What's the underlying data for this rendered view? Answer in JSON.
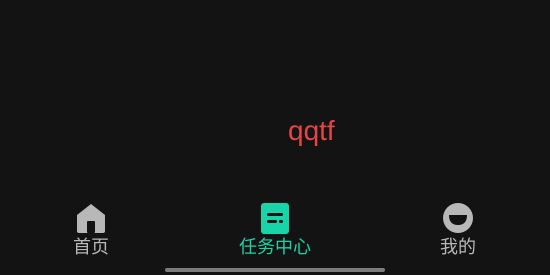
{
  "main": {
    "center_text": "qqtf"
  },
  "tabbar": {
    "tabs": [
      {
        "label": "首页",
        "icon": "home-icon",
        "active": false
      },
      {
        "label": "任务中心",
        "icon": "task-icon",
        "active": true
      },
      {
        "label": "我的",
        "icon": "profile-smile-icon",
        "active": false
      }
    ]
  },
  "colors": {
    "background": "#131313",
    "accent": "#19d4a8",
    "text_red": "#e64545",
    "tab_inactive": "#b8b8b8"
  }
}
